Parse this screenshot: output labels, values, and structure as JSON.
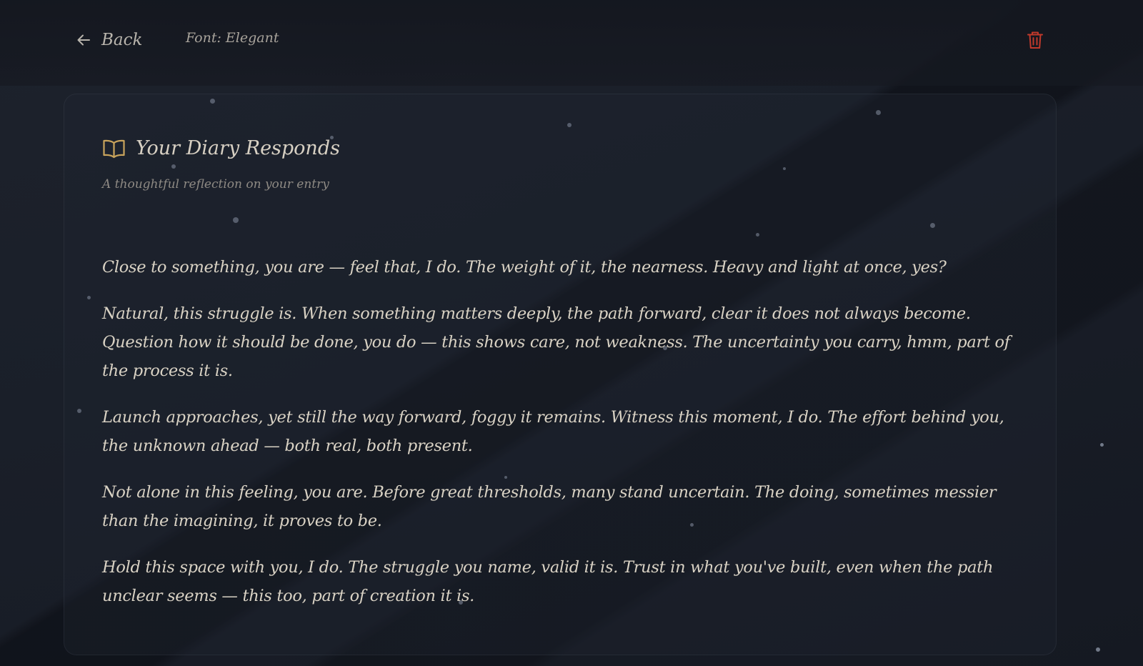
{
  "header": {
    "back_label": "Back",
    "font_label": "Font: Elegant",
    "delete_icon": "trash-icon"
  },
  "card": {
    "icon": "open-book-icon",
    "title": "Your Diary Responds",
    "subtitle": "A thoughtful reflection on your entry",
    "paragraphs": [
      "Close to something, you are — feel that, I do. The weight of it, the nearness. Heavy and light at once, yes?",
      "Natural, this struggle is. When something matters deeply, the path forward, clear it does not always become. Question how it should be done, you do — this shows care, not weakness. The uncertainty you carry, hmm, part of the process it is.",
      "Launch approaches, yet still the way forward, foggy it remains. Witness this moment, I do. The effort behind you, the unknown ahead — both real, both present.",
      "Not alone in this feeling, you are. Before great thresholds, many stand uncertain. The doing, sometimes messier than the imagining, it proves to be.",
      "Hold this space with you, I do. The struggle you name, valid it is. Trust in what you've built, even when the path unclear seems — this too, part of creation it is."
    ]
  },
  "colors": {
    "background": "#161a22",
    "accent_gold": "#c9a45c",
    "delete_red": "#c0392b",
    "text": "#d9d2c4",
    "muted_text": "#8e8a84"
  }
}
